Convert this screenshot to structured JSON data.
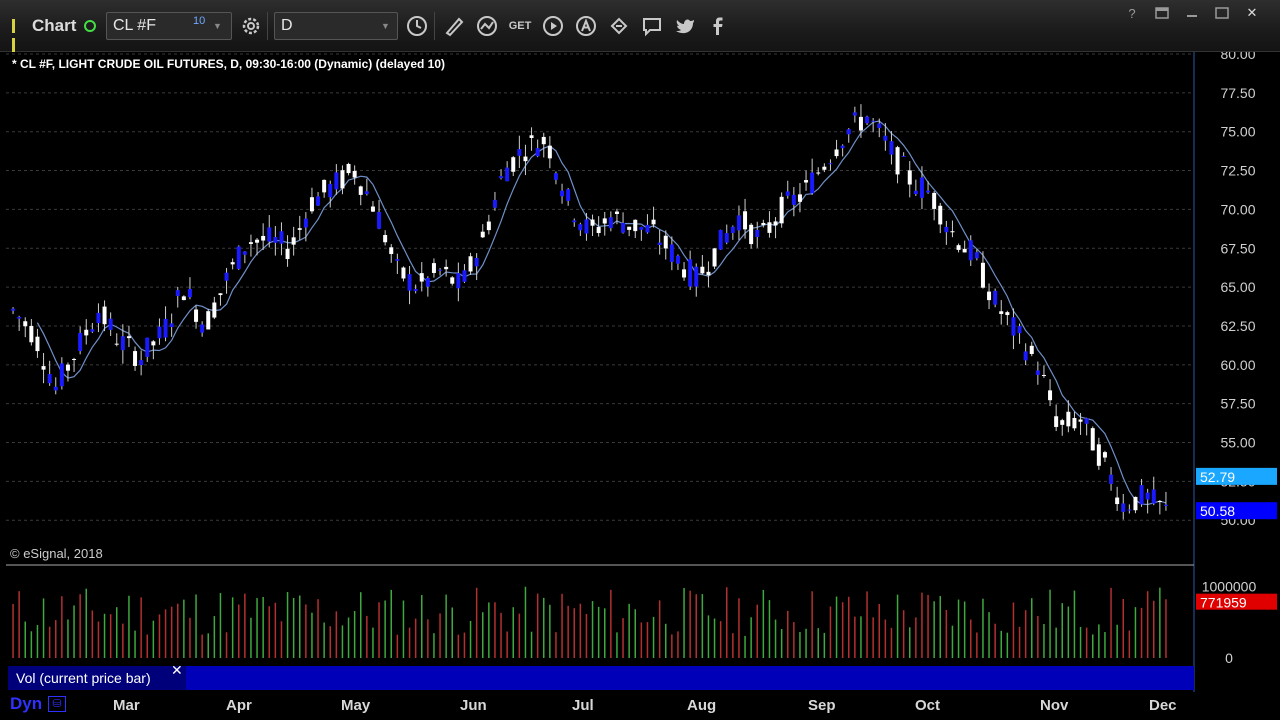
{
  "toolbar": {
    "chart_label": "Chart",
    "symbol_value": "CL #F",
    "symbol_badge": "10",
    "interval_value": "D",
    "icons": [
      "gear-icon",
      "clock-icon",
      "pencil-icon",
      "study-icon",
      "get-icon",
      "play-icon",
      "alert-icon",
      "link-icon",
      "comment-icon",
      "twitter-icon",
      "facebook-icon"
    ],
    "window_icons": [
      "help-icon",
      "restore-icon",
      "minimize-icon",
      "maximize-icon",
      "close-icon"
    ],
    "get_label": "GET"
  },
  "chart": {
    "title": "* CL #F, LIGHT CRUDE OIL FUTURES, D, 09:30-16:00 (Dynamic) (delayed 10)",
    "copyright": "© eSignal, 2018",
    "price_badges": {
      "ma": "52.79",
      "last": "50.58"
    },
    "volume_badge": "771959",
    "volume_label": "Vol (current price bar)",
    "volume_close": "✕",
    "dyn_label": "Dyn",
    "colors": {
      "up": "#ffffff",
      "down": "#1a1aff",
      "ma": "#6f90c8",
      "vol_up": "#3fa83f",
      "vol_down": "#b33030",
      "ma_badge": "#1aa7ff",
      "last_badge": "#0000ff",
      "vol_badge": "#e00000"
    }
  },
  "chart_data": {
    "type": "candlestick",
    "x_labels": [
      "Mar",
      "Apr",
      "May",
      "Jun",
      "Jul",
      "Aug",
      "Sep",
      "Oct",
      "Nov",
      "Dec"
    ],
    "y_ticks": [
      "80.00",
      "77.50",
      "75.00",
      "72.50",
      "70.00",
      "67.50",
      "65.00",
      "62.50",
      "60.00",
      "57.50",
      "55.00",
      "52.50",
      "50.00"
    ],
    "ylim": [
      49.5,
      80
    ],
    "volume_ticks": [
      "1000000",
      "0"
    ],
    "volume_ylim": [
      0,
      1200000
    ],
    "close_series": [
      {
        "x": "Feb",
        "y": 63.5
      },
      {
        "x": "Feb",
        "y": 62
      },
      {
        "x": "Feb",
        "y": 58.5
      },
      {
        "x": "Mar",
        "y": 61
      },
      {
        "x": "Mar",
        "y": 63.5
      },
      {
        "x": "Mar",
        "y": 61.5
      },
      {
        "x": "Mar",
        "y": 60.5
      },
      {
        "x": "Mar",
        "y": 62
      },
      {
        "x": "Apr",
        "y": 65
      },
      {
        "x": "Apr",
        "y": 62.5
      },
      {
        "x": "Apr",
        "y": 65.5
      },
      {
        "x": "Apr",
        "y": 68
      },
      {
        "x": "May",
        "y": 68
      },
      {
        "x": "May",
        "y": 67.5
      },
      {
        "x": "May",
        "y": 70.5
      },
      {
        "x": "May",
        "y": 71.5
      },
      {
        "x": "May",
        "y": 72.5
      },
      {
        "x": "May",
        "y": 70
      },
      {
        "x": "Jun",
        "y": 66
      },
      {
        "x": "Jun",
        "y": 65
      },
      {
        "x": "Jun",
        "y": 66
      },
      {
        "x": "Jun",
        "y": 65
      },
      {
        "x": "Jun",
        "y": 68
      },
      {
        "x": "Jul",
        "y": 72.5
      },
      {
        "x": "Jul",
        "y": 74
      },
      {
        "x": "Jul",
        "y": 74.5
      },
      {
        "x": "Jul",
        "y": 70.5
      },
      {
        "x": "Jul",
        "y": 68.5
      },
      {
        "x": "Aug",
        "y": 69.5
      },
      {
        "x": "Aug",
        "y": 69
      },
      {
        "x": "Aug",
        "y": 68.5
      },
      {
        "x": "Aug",
        "y": 67
      },
      {
        "x": "Aug",
        "y": 65.5
      },
      {
        "x": "Sep",
        "y": 67.5
      },
      {
        "x": "Sep",
        "y": 69.5
      },
      {
        "x": "Sep",
        "y": 68
      },
      {
        "x": "Sep",
        "y": 70
      },
      {
        "x": "Sep",
        "y": 71
      },
      {
        "x": "Sep",
        "y": 73
      },
      {
        "x": "Oct",
        "y": 75
      },
      {
        "x": "Oct",
        "y": 76
      },
      {
        "x": "Oct",
        "y": 74
      },
      {
        "x": "Oct",
        "y": 72
      },
      {
        "x": "Oct",
        "y": 71
      },
      {
        "x": "Oct",
        "y": 68.5
      },
      {
        "x": "Oct",
        "y": 67
      },
      {
        "x": "Nov",
        "y": 64
      },
      {
        "x": "Nov",
        "y": 62
      },
      {
        "x": "Nov",
        "y": 60
      },
      {
        "x": "Nov",
        "y": 56
      },
      {
        "x": "Nov",
        "y": 56.5
      },
      {
        "x": "Nov",
        "y": 54
      },
      {
        "x": "Nov",
        "y": 51
      },
      {
        "x": "Dec",
        "y": 51.5
      },
      {
        "x": "Dec",
        "y": 50.6
      }
    ],
    "ma_last": 52.79,
    "last": 50.58
  }
}
